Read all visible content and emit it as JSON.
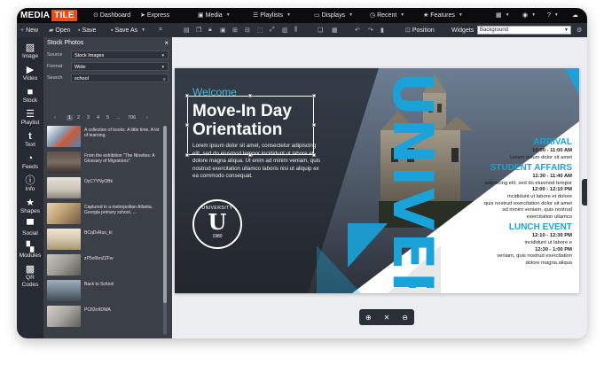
{
  "brand": {
    "logo_part1": "MEDIA",
    "logo_part2": "TILE"
  },
  "topnav": {
    "dashboard": "Dashboard",
    "express": "Express",
    "media": "Media",
    "playlists": "Playlists",
    "displays": "Displays",
    "recent": "Recent",
    "features": "Features"
  },
  "toolbar": {
    "new": "New",
    "open": "Open",
    "save": "Save",
    "save_as": "Save As",
    "position": "Position",
    "widgets_label": "Widgets",
    "widgets_value": "Background"
  },
  "rail": [
    {
      "icon": "image-icon",
      "label": "Image"
    },
    {
      "icon": "video-icon",
      "label": "Video"
    },
    {
      "icon": "stock-icon",
      "label": "Stock"
    },
    {
      "icon": "playlist-icon",
      "label": "Playlist"
    },
    {
      "icon": "text-icon",
      "label": "Text"
    },
    {
      "icon": "feeds-icon",
      "label": "Feeds"
    },
    {
      "icon": "info-icon",
      "label": "Info"
    },
    {
      "icon": "shapes-icon",
      "label": "Shapes"
    },
    {
      "icon": "social-icon",
      "label": "Social"
    },
    {
      "icon": "modules-icon",
      "label": "Modules"
    },
    {
      "icon": "qr-codes-icon",
      "label": "QR Codes"
    }
  ],
  "panel": {
    "title": "Stock Photos",
    "source_label": "Source",
    "source_value": "Stock Images",
    "format_label": "Format",
    "format_value": "Wide",
    "search_label": "Search",
    "search_value": "school",
    "pages": [
      "1",
      "2",
      "3",
      "4",
      "5",
      "...",
      "706"
    ],
    "current_page": "1",
    "results": [
      {
        "text": "A collection of books. A little time. A lot of learning.",
        "color": "#8a9bb0"
      },
      {
        "text": "From the exhibition \"The Nineties: A Glossary of Migrations\".",
        "color": "#7b6e62"
      },
      {
        "text": "OyC7YNyOBk",
        "color": "#c9c3b5"
      },
      {
        "text": "Captured in a metropolitan Atlanta, Georgia primary school, ...",
        "color": "#b89a6e"
      },
      {
        "text": "BCqDvRuo_kI",
        "color": "#d4c7aa"
      },
      {
        "text": "zP5o6bnZZFw",
        "color": "#9e9a95"
      },
      {
        "text": "Back to School",
        "color": "#6f7f8c"
      },
      {
        "text": "PCfI2rrlIDWA",
        "color": "#a7a49e"
      }
    ]
  },
  "slide": {
    "welcome": "Welcome",
    "title_line1": "Move-In Day",
    "title_line2": "Orientation",
    "body": "Lorem ipsum dolor sit amet, consectetur adipiscing elit, sed do eiusmod tempor incididunt ut labore et dolore magna aliqua. Ut enim ad minim veniam, quis nostrud exercitation ullamco laboris nisi ut aliquip ex ea commodo consequat.",
    "seal_top": "UNIVERSITY",
    "seal_letter": "U",
    "seal_year": "1980",
    "vertical_word": "UNIVER",
    "arrival_title": "ARRIVAL",
    "arrival_time": "10:00 - 11:00 AM",
    "arrival_text": "Lorem ipsum dolor sit amet",
    "student_title": "STUDENT AFFAIRS",
    "student_time1": "11:30 - 11:40 AM",
    "student_text1": "adipiscing elit, sed do eiusmod tempor",
    "student_time2": "12:00 - 12:10 PM",
    "student_text2": "incididunt ut labore et dolore",
    "student_text3": "quis nostrud exercitation dolor sit amet",
    "student_text4": "ad minim veniam, quis nostrud",
    "student_text5": "exercitation ullamco",
    "lunch_title": "LUNCH EVENT",
    "lunch_time1": "12:10 - 12:30 PM",
    "lunch_text1": "incididunt ut labore e",
    "lunch_time2": "12:30 - 1:00 PM",
    "lunch_text2": "veniam, quis nostrud exercitation",
    "lunch_text3": "dolore magna aliqua"
  },
  "colors": {
    "accent_blue": "#1aa3d9",
    "brand_orange": "#e84c1a",
    "dark_nav": "#0c0c0e",
    "toolbar": "#2b3038"
  }
}
